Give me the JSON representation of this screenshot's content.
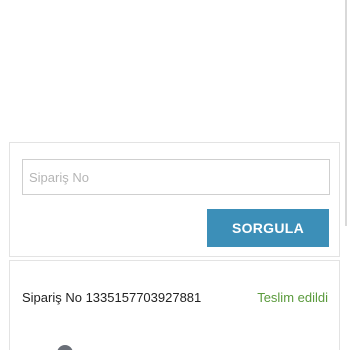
{
  "query": {
    "input_placeholder": "Sipariş No",
    "input_value": "",
    "button_label": "SORGULA",
    "button_color": "#3c8fb8"
  },
  "result": {
    "order_number_label": "Sipariş No 1335157703927881",
    "status_label": "Teslim edildi",
    "status_color": "#5a9a3c"
  }
}
